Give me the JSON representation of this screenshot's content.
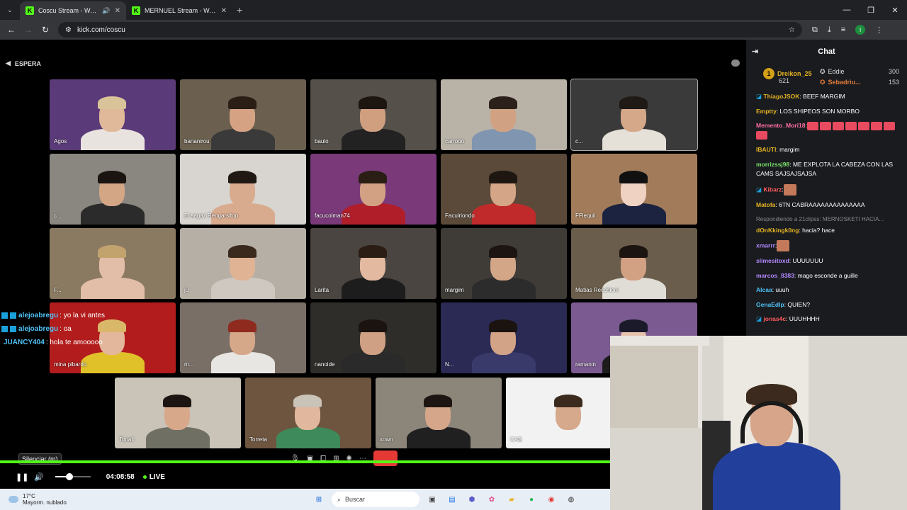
{
  "browser": {
    "tabs": [
      {
        "title": "Coscu Stream - Watch Live",
        "active": true
      },
      {
        "title": "MERNUEL Stream - Watch Live",
        "active": false
      }
    ],
    "url": "kick.com/coscu",
    "profile_initial": "I"
  },
  "stream": {
    "status_label": "ESPERA",
    "cams": [
      {
        "label": "Agos",
        "bg": "#5a3a78",
        "skin": "#e0b89a",
        "hair": "#d9c49a",
        "shirt": "#e9e3e0"
      },
      {
        "label": "bananirou",
        "bg": "#6b5f4f",
        "skin": "#d5a384",
        "hair": "#2a1e15",
        "shirt": "#3a3a3a"
      },
      {
        "label": "baulo",
        "bg": "#55514a",
        "skin": "#cf9f80",
        "hair": "#1d1510",
        "shirt": "#222"
      },
      {
        "label": "carrooo",
        "bg": "#b9b2a6",
        "skin": "#d0a283",
        "hair": "#2b211a",
        "shirt": "#7f95b0"
      },
      {
        "label": "c...",
        "bg": "#3a3a3a",
        "skin": "#d6a88a",
        "hair": "#1f1a16",
        "shirt": "#e5e0d8"
      },
      {
        "label": "c...",
        "bg": "#8a8780",
        "skin": "#d3a686",
        "hair": "#1b1512",
        "shirt": "#2b2b2b"
      },
      {
        "label": "El sagaz Rengarsitoo",
        "bg": "#d8d4cf",
        "skin": "#d9ab8e",
        "hair": "#201812",
        "shirt": "#d9ab8e"
      },
      {
        "label": "facucolman74",
        "bg": "#7a3a7a",
        "skin": "#d2a184",
        "hair": "#2a1d14",
        "shirt": "#b01e2a"
      },
      {
        "label": "Faculriondo",
        "bg": "#5b4a3a",
        "skin": "#d4a586",
        "hair": "#1e1611",
        "shirt": "#c02a2a"
      },
      {
        "label": "FFlequii",
        "bg": "#a27c5a",
        "skin": "#efd2c2",
        "hair": "#111",
        "shirt": "#1b2340"
      },
      {
        "label": "F...",
        "bg": "#8a7a62",
        "skin": "#e2bea8",
        "hair": "#c2a36e",
        "shirt": "#e2bea8"
      },
      {
        "label": "ju",
        "bg": "#b6afa5",
        "skin": "#e0b395",
        "hair": "#3a2a1e",
        "shirt": "#cfc8c0"
      },
      {
        "label": "Larita",
        "bg": "#4a4540",
        "skin": "#e3b9a0",
        "hair": "#2b1d14",
        "shirt": "#1d1d1d"
      },
      {
        "label": "margim",
        "bg": "#3f3c38",
        "skin": "#d3a687",
        "hair": "#1d1511",
        "shirt": "#2c2c2c"
      },
      {
        "label": "Matias Recchioni",
        "bg": "#6a5d4b",
        "skin": "#d2a184",
        "hair": "#1c1410",
        "shirt": "#e0ddd6"
      },
      {
        "label": "mina pibardo",
        "bg": "#b21c1c",
        "skin": "#e2b79b",
        "hair": "#d9b86a",
        "shirt": "#e0c12a"
      },
      {
        "label": "m...",
        "bg": "#7a6f66",
        "skin": "#d6a88a",
        "hair": "#8e2a1e",
        "shirt": "#e8e6e2"
      },
      {
        "label": "nanoide",
        "bg": "#2f2d2a",
        "skin": "#cfa083",
        "hair": "#1a1310",
        "shirt": "#2a2a2a"
      },
      {
        "label": "N...",
        "bg": "#2a2a55",
        "skin": "#d2a386",
        "hair": "#1a1310",
        "shirt": "#3a3a6a"
      },
      {
        "label": "ramanin",
        "bg": "#7a5a90",
        "skin": "#e6c2ad",
        "hair": "#1a1a2a",
        "shirt": "#1c1c1c"
      },
      {
        "label": "Tonali",
        "bg": "#c9c3b8",
        "skin": "#d7a88a",
        "hair": "#1b1410",
        "shirt": "#6f6f63"
      },
      {
        "label": "Torreta",
        "bg": "#6e5540",
        "skin": "#e1b89d",
        "hair": "#c9c3b8",
        "shirt": "#3e8a5a"
      },
      {
        "label": "xown",
        "bg": "#8c857a",
        "skin": "#d5a689",
        "hair": "#1c1511",
        "shirt": "#202020"
      },
      {
        "label": "CAS",
        "bg": "#f2f2f2",
        "skin": "#d6a98c",
        "hair": "#3a2b1e",
        "shirt": "#f2f2f2"
      }
    ],
    "overlay_chat": [
      {
        "user": "alejoabregu",
        "text": ": yo la vi antes",
        "badge": true
      },
      {
        "user": "alejoabregu",
        "text": ": oa",
        "badge": true
      },
      {
        "user": "JUANCY404",
        "text": ": hola te amooooo",
        "badge": false
      }
    ],
    "tooltip": "Silenciar (m)",
    "time": "04:08:58",
    "live": "LIVE",
    "volume": 0.4
  },
  "chat": {
    "title": "Chat",
    "top_gifter": {
      "rank": "1",
      "name": "Dreikon_25",
      "count": "621"
    },
    "gifters": [
      {
        "name": "Eddie",
        "count": "300"
      },
      {
        "name": "Sebadriu...",
        "count": "153"
      }
    ],
    "messages": [
      {
        "user": "ThiagoJSOK",
        "color": "#e6b422",
        "text": ": BEEF MARGIM",
        "badge": true
      },
      {
        "user": "Emptty",
        "color": "#e6b422",
        "text": ": LOS SHIPEOS SON MORBO"
      },
      {
        "user": "Memento_Mori18",
        "color": "#ff6fa1",
        "text": ":",
        "emotes": 8
      },
      {
        "user": "IBAUTI",
        "color": "#e6b422",
        "text": ": margim"
      },
      {
        "user": "morrizssj98",
        "color": "#7ee36b",
        "text": ": ME EXPLOTA LA CABEZA CON LAS CAMS SAJSAJSAJSA"
      },
      {
        "user": "Kibarz",
        "color": "#ff5a5a",
        "text": ":",
        "face": true,
        "badge": true
      },
      {
        "user": "Matofa",
        "color": "#e6b422",
        "text": ": 6TN CABRAAAAAAAAAAAAAA"
      },
      {
        "user": "dOnKkingk0ng",
        "color": "#e6b422",
        "text": ": hacia? hace",
        "reply": "Respondiendo a 21clipss: MERNOSKETI HACIA..."
      },
      {
        "user": "xmarrr",
        "color": "#b388ff",
        "text": ":",
        "face": true
      },
      {
        "user": "slimesitoxd",
        "color": "#b388ff",
        "text": ": UUUUUUU"
      },
      {
        "user": "marcos_8383",
        "color": "#b388ff",
        "text": ": mago esconde a guille"
      },
      {
        "user": "Alcaa",
        "color": "#4fc3f7",
        "text": ": uuuh"
      },
      {
        "user": "GenaEdIp",
        "color": "#4fc3f7",
        "text": ": QUIEN?"
      },
      {
        "user": "jonas4c",
        "color": "#ff5a5a",
        "text": ": UUUHHHH",
        "badge": true
      }
    ]
  },
  "taskbar": {
    "temp": "17°C",
    "weather": "Mayorm. nublado",
    "search_placeholder": "Buscar"
  }
}
